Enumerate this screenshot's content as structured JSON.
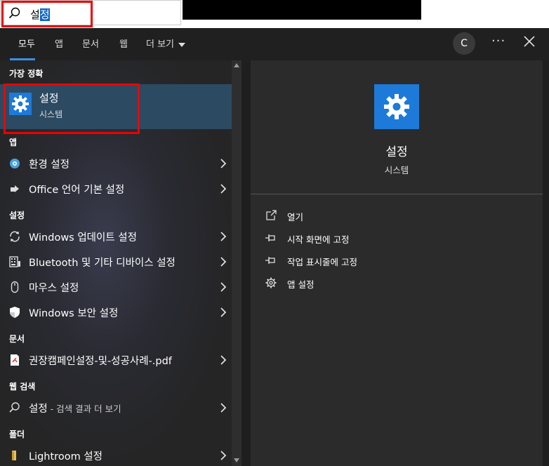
{
  "search": {
    "query_prefix": "설",
    "query_selected": "정"
  },
  "tabs": [
    {
      "label": "모두"
    },
    {
      "label": "앱"
    },
    {
      "label": "문서"
    },
    {
      "label": "웹"
    },
    {
      "label": "더 보기"
    }
  ],
  "header": {
    "avatar_letter": "C",
    "more_label": "···"
  },
  "sections": {
    "best_match": "가장 정확",
    "apps": "앱",
    "settings": "설정",
    "documents": "문서",
    "web": "웹 검색",
    "folders": "폴더"
  },
  "best_match": {
    "title": "설정",
    "subtitle": "시스템"
  },
  "apps": [
    {
      "label": "환경 설정",
      "icon": "control-panel-icon"
    },
    {
      "label": "Office 언어 기본 설정",
      "icon": "office-language-icon"
    }
  ],
  "settings": [
    {
      "label": "Windows 업데이트 설정",
      "icon": "refresh-icon"
    },
    {
      "label": "Bluetooth 및 기타 디바이스 설정",
      "icon": "keyboard-icon"
    },
    {
      "label": "마우스 설정",
      "icon": "mouse-icon"
    },
    {
      "label": "Windows 보안 설정",
      "icon": "shield-icon"
    }
  ],
  "documents": [
    {
      "label": "권장캠페인설정-및-성공사례-.pdf",
      "icon": "pdf-icon"
    }
  ],
  "web": {
    "query": "설정",
    "suffix": " - 검색 결과 더 보기"
  },
  "folders": [
    {
      "label": "Lightroom 설정",
      "icon": "folder-icon"
    }
  ],
  "preview": {
    "title": "설정",
    "subtitle": "시스템",
    "actions": [
      {
        "label": "열기",
        "icon": "open-icon"
      },
      {
        "label": "시작 화면에 고정",
        "icon": "pin-icon"
      },
      {
        "label": "작업 표시줄에 고정",
        "icon": "pin-icon"
      },
      {
        "label": "앱 설정",
        "icon": "gear-icon"
      }
    ]
  },
  "colors": {
    "accent": "#1d7ad9",
    "highlight": "#e00000",
    "selection": "#2c4a62"
  }
}
